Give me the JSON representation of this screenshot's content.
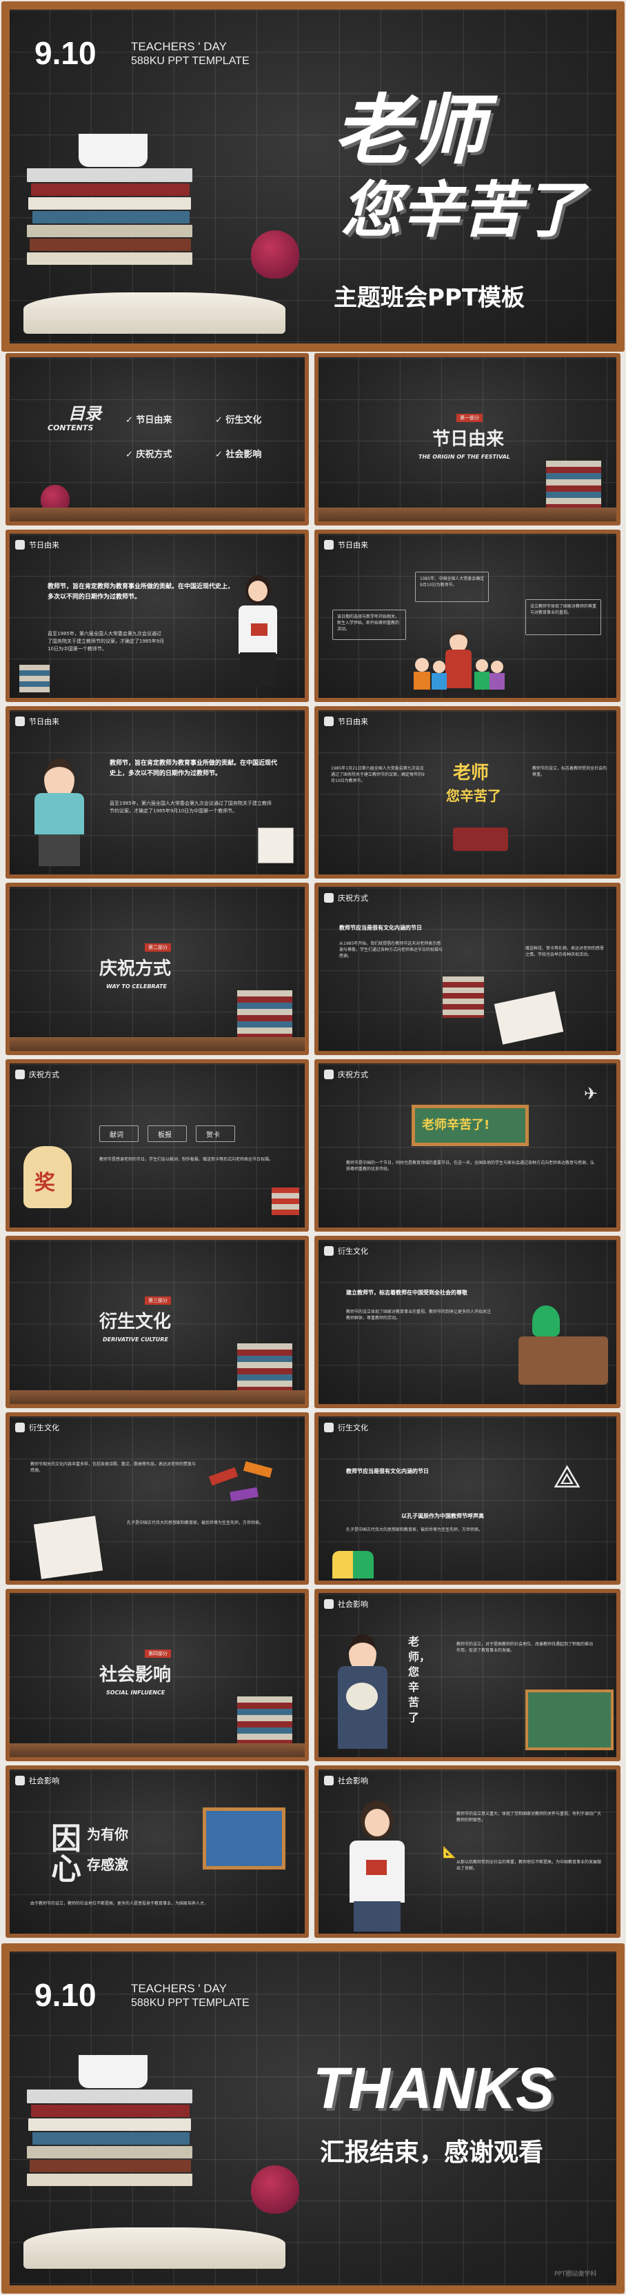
{
  "colors": {
    "wood": "#9a5b2f",
    "board": "#262626",
    "accent_red": "#c0392b",
    "chalk": "#eeeeee"
  },
  "cover": {
    "date": "9.10",
    "teachers_day": "TEACHERS ' DAY",
    "template": "588KU PPT TEMPLATE",
    "title1": "老师",
    "title2": "您辛苦了",
    "subtitle": "主题班会PPT模板"
  },
  "toc": {
    "title": "目录",
    "subtitle": "CONTENTS",
    "items": [
      "节日由来",
      "衍生文化",
      "庆祝方式",
      "社会影响"
    ]
  },
  "part1": {
    "badge": "第一部分",
    "title": "节日由来",
    "subtitle": "THE ORIGIN OF THE FESTIVAL"
  },
  "part2": {
    "badge": "第二部分",
    "title": "庆祝方式",
    "subtitle": "WAY TO CELEBRATE"
  },
  "part3": {
    "badge": "第三部分",
    "title": "衍生文化",
    "subtitle": "DERIVATIVE CULTURE"
  },
  "part4": {
    "badge": "第四部分",
    "title": "社会影响",
    "subtitle": "SOCIAL INFLUENCE"
  },
  "tags": {
    "origin": "节日由来",
    "celebrate": "庆祝方式",
    "culture": "衍生文化",
    "social": "社会影响"
  },
  "s_origin1": {
    "heading": "教师节，旨在肯定教师为教育事业所做的贡献。在中国近现代史上，多次以不同的日期作为过教师节。",
    "body": "直至1985年，第六届全国人大常委会第九次会议通过了国务院关于建立教师节的议案，才确定了1985年9月10日为中国第一个教师节。"
  },
  "s_origin2": {
    "box1": "1985年，中国全国人大常委会确定9月10日为教师节。",
    "box2": "该日期的选择与新学年开始相关，新生入学伊始，即开始尊师重教的活动。",
    "box3": "设立教师节体现了国家对教师的尊重与对教育事业的重视。"
  },
  "s_origin3": {
    "heading": "教师节，旨在肯定教师为教育事业所做的贡献。在中国近现代史上，多次以不同的日期作为过教师节。",
    "body": "直至1985年，第六届全国人大常委会第九次会议通过了国务院关于建立教师节的议案，才确定了1985年9月10日为中国第一个教师节。"
  },
  "s_origin4": {
    "left": "1985年1月21日第六届全国人大常委会第九次会议通过了国务院关于建立教师节的议案，确定每年的9月10日为教师节。",
    "right": "教师节的设立，标志着教师受到全社会的尊重。",
    "sign_line1": "老师",
    "sign_line2": "您辛苦了"
  },
  "s_cele1": {
    "heading": "教师节应当是很有文化内涵的节日",
    "body": "从1985年开始，我们就提倡在教师节这天对老师表示感谢与尊敬，学生们通过各种方式向老师表达节日的祝福与感谢。",
    "right": "赠送鲜花、贺卡等礼物，表达对老师的感恩之情。学校也会举办各种庆祝活动。"
  },
  "s_cele2": {
    "buttons": [
      "献词",
      "板报",
      "贺卡"
    ],
    "body": "教师节是感谢老师的节日，学生们会以献词、制作板报、赠送贺卡等形式向老师表达节日祝福。",
    "jar_char": "奖"
  },
  "s_cele3": {
    "blackboard": "老师辛苦了!",
    "body": "教师节是中国的一个节日，同时也是教育领域的重要节日。在这一天，全国各地的学生与家长会通过各种方式向老师表达敬意与感谢，弘扬尊师重教的优良传统。"
  },
  "s_cult1": {
    "heading": "建立教师节，标志着教师在中国受到全社会的尊敬",
    "body": "教师节的设立体现了国家对教育事业的重视。教师节的到来让更多的人开始关注教师群体，尊重教师的劳动。"
  },
  "s_cult2": {
    "box_left": "教师节相关的文化内容丰富多样，包括各类诗歌、散文、歌曲等作品，表达对老师的赞美与感激。",
    "box_title1": "教师节应当是很有文化内涵的节日",
    "box_title2": "以孔子诞辰作为中国教师节呼声高",
    "body": "孔子是中国古代伟大的思想家和教育家，被后世尊为至圣先师，万世师表。"
  },
  "s_soc1": {
    "side_text": "老师，您辛苦了",
    "body": "教师节的设立，对于提高教师的社会地位、改善教师待遇起到了积极的推动作用，促进了教育事业的发展。"
  },
  "s_soc2": {
    "hero": "因为有你心存感激",
    "hero_big1": "因",
    "hero_small1": "为有你",
    "hero_big2": "心",
    "hero_small2": "存感激",
    "body": "由于教师节的设立，教师的社会地位不断提高，更多的人愿意投身于教育事业，为国家培养人才。"
  },
  "s_soc3": {
    "body1": "教师节的设立意义重大，体现了党和国家对教师的关怀与重视，有利于调动广大教师的积极性。",
    "body2": "从那以后教师受到全社会的尊重，教师地位不断提高，为中国教育事业的发展做出了贡献。"
  },
  "final": {
    "date": "9.10",
    "teachers_day": "TEACHERS ' DAY",
    "template": "588KU PPT TEMPLATE",
    "thanks": "THANKS",
    "subtitle": "汇报结束，感谢观看",
    "watermark": "PPT圈站做学科"
  }
}
